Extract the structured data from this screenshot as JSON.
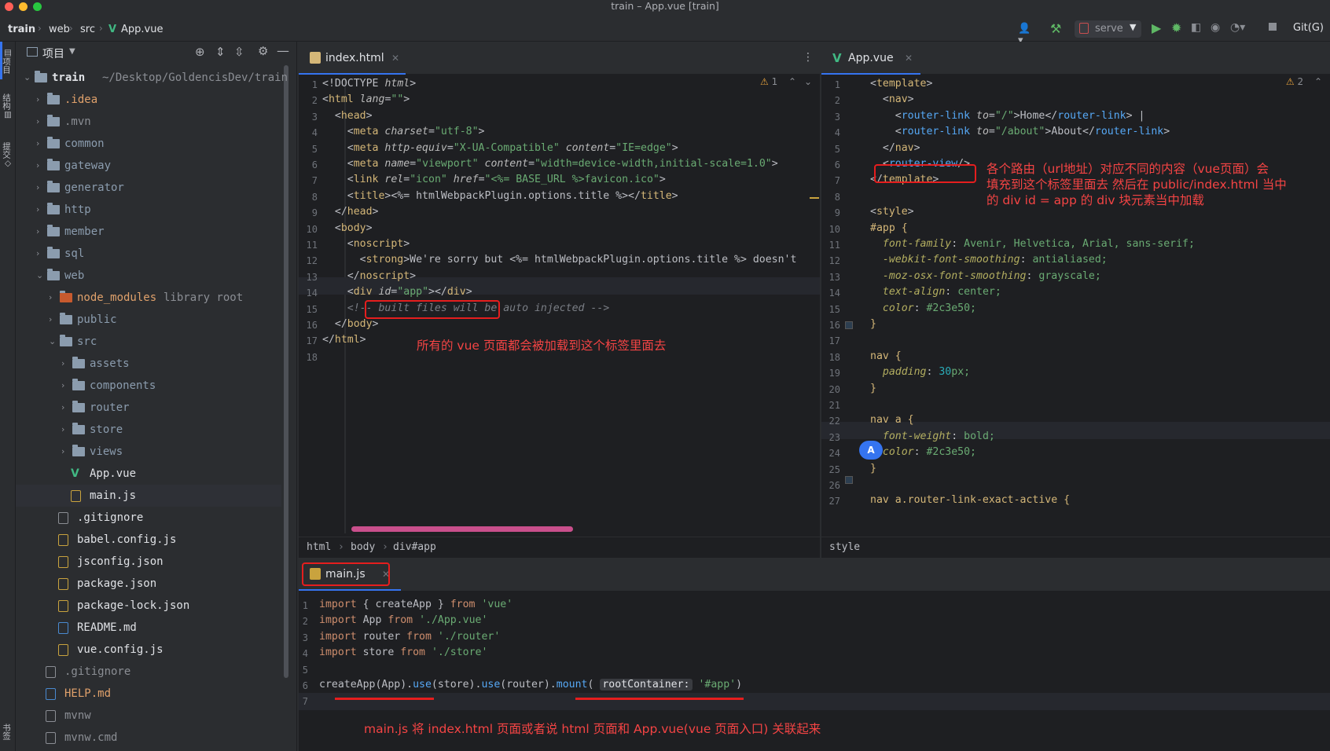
{
  "window": {
    "title": "train – App.vue [train]"
  },
  "nav": {
    "breadcrumb": [
      "train",
      "web",
      "src",
      "App.vue"
    ],
    "run_config": "serve",
    "git_label": "Git(G)"
  },
  "left_strip": {
    "labels": [
      "项目",
      "结构",
      "提交",
      "书签"
    ]
  },
  "project": {
    "header_label": "项目",
    "root_name": "train",
    "root_path": "~/Desktop/GoldencisDev/train",
    "items": [
      {
        "name": ".idea",
        "type": "folder",
        "level": 1
      },
      {
        "name": ".mvn",
        "type": "folder",
        "level": 1
      },
      {
        "name": "common",
        "type": "folder",
        "level": 1
      },
      {
        "name": "gateway",
        "type": "folder",
        "level": 1
      },
      {
        "name": "generator",
        "type": "folder",
        "level": 1
      },
      {
        "name": "http",
        "type": "folder",
        "level": 1
      },
      {
        "name": "member",
        "type": "folder",
        "level": 1
      },
      {
        "name": "sql",
        "type": "folder",
        "level": 1
      },
      {
        "name": "web",
        "type": "folder-open",
        "level": 1
      },
      {
        "name": "node_modules",
        "type": "folder-lib",
        "level": 2,
        "suffix": "library root"
      },
      {
        "name": "public",
        "type": "folder",
        "level": 2
      },
      {
        "name": "src",
        "type": "folder-open",
        "level": 2
      },
      {
        "name": "assets",
        "type": "folder",
        "level": 3
      },
      {
        "name": "components",
        "type": "folder",
        "level": 3
      },
      {
        "name": "router",
        "type": "folder",
        "level": 3
      },
      {
        "name": "store",
        "type": "folder",
        "level": 3
      },
      {
        "name": "views",
        "type": "folder",
        "level": 3
      },
      {
        "name": "App.vue",
        "type": "vue",
        "level": 3
      },
      {
        "name": "main.js",
        "type": "js",
        "level": 3
      },
      {
        "name": ".gitignore",
        "type": "file",
        "level": 2
      },
      {
        "name": "babel.config.js",
        "type": "js",
        "level": 2
      },
      {
        "name": "jsconfig.json",
        "type": "json",
        "level": 2
      },
      {
        "name": "package.json",
        "type": "json",
        "level": 2
      },
      {
        "name": "package-lock.json",
        "type": "json",
        "level": 2
      },
      {
        "name": "README.md",
        "type": "md",
        "level": 2
      },
      {
        "name": "vue.config.js",
        "type": "js",
        "level": 2
      },
      {
        "name": ".gitignore",
        "type": "file",
        "level": 1
      },
      {
        "name": "HELP.md",
        "type": "md",
        "level": 1
      },
      {
        "name": "mvnw",
        "type": "file",
        "level": 1
      },
      {
        "name": "mvnw.cmd",
        "type": "file",
        "level": 1
      }
    ]
  },
  "editor1": {
    "tab_label": "index.html",
    "warning_count": "1",
    "line_numbers": [
      "1",
      "2",
      "3",
      "4",
      "5",
      "6",
      "7",
      "8",
      "9",
      "10",
      "11",
      "12",
      "13",
      "14",
      "15",
      "16",
      "17",
      "18"
    ],
    "lines": [
      "<!DOCTYPE html>",
      "<html lang=\"\">",
      "  <head>",
      "    <meta charset=\"utf-8\">",
      "    <meta http-equiv=\"X-UA-Compatible\" content=\"IE=edge\">",
      "    <meta name=\"viewport\" content=\"width=device-width,initial-scale=1.0\">",
      "    <link rel=\"icon\" href=\"<%= BASE_URL %>favicon.ico\">",
      "    <title><%= htmlWebpackPlugin.options.title %></title>",
      "  </head>",
      "  <body>",
      "    <noscript>",
      "      <strong>We're sorry but <%= htmlWebpackPlugin.options.title %> doesn't",
      "    </noscript>",
      "    <div id=\"app\"></div>",
      "    <!-- built files will be auto injected -->",
      "  </body>",
      "</html>",
      ""
    ],
    "breadcrumb": [
      "html",
      "body",
      "div#app"
    ],
    "annotation": "所有的 vue 页面都会被加载到这个标签里面去"
  },
  "editor2": {
    "tab_label": "App.vue",
    "warning_count": "2",
    "line_numbers": [
      "1",
      "2",
      "3",
      "4",
      "5",
      "6",
      "7",
      "8",
      "9",
      "10",
      "11",
      "12",
      "13",
      "14",
      "15",
      "16",
      "17",
      "18",
      "19",
      "20",
      "21",
      "22",
      "23",
      "24",
      "25",
      "26",
      "27"
    ],
    "lines": [
      "<template>",
      "  <nav>",
      "    <router-link to=\"/\">Home</router-link> |",
      "    <router-link to=\"/about\">About</router-link>",
      "  </nav>",
      "  <router-view/>",
      "</template>",
      "",
      "<style>",
      "#app {",
      "  font-family: Avenir, Helvetica, Arial, sans-serif;",
      "  -webkit-font-smoothing: antialiased;",
      "  -moz-osx-font-smoothing: grayscale;",
      "  text-align: center;",
      "  color: #2c3e50;",
      "}",
      "",
      "nav {",
      "  padding: 30px;",
      "}",
      "",
      "nav a {",
      "  font-weight: bold;",
      "  color: #2c3e50;",
      "}",
      "",
      "nav a.router-link-exact-active {"
    ],
    "breadcrumb": [
      "style"
    ],
    "annotation_lines": [
      "各个路由（url地址）对应不同的内容（vue页面）会",
      "填充到这个标签里面去 然后在 public/index.html 当中",
      "的 div id = app 的 div 块元素当中加载"
    ],
    "avatar_letter": "A"
  },
  "editor3": {
    "tab_label": "main.js",
    "line_numbers": [
      "1",
      "2",
      "3",
      "4",
      "5",
      "6",
      "7"
    ],
    "lines": [
      "import { createApp } from 'vue'",
      "import App from './App.vue'",
      "import router from './router'",
      "import store from './store'",
      "",
      "createApp(App).use(store).use(router).mount( rootContainer: '#app')",
      ""
    ],
    "annotation": "main.js 将 index.html 页面或者说 html 页面和 App.vue(vue 页面入口) 关联起来"
  }
}
